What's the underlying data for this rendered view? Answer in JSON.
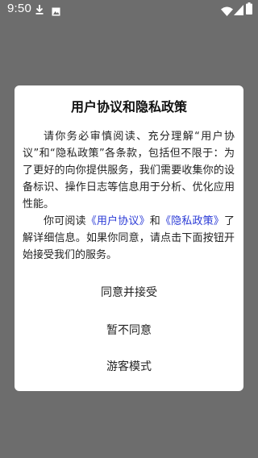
{
  "status_bar": {
    "time": "9:50",
    "icons": [
      "download-icon",
      "gallery-icon",
      "wifi-icon",
      "signal-icon",
      "battery-icon"
    ]
  },
  "dialog": {
    "title": "用户协议和隐私政策",
    "paragraph1": "请你务必审慎阅读、充分理解“用户协议”和“隐私政策”各条款，包括但不限于：为了更好的向你提供服务，我们需要收集你的设备标识、操作日志等信息用于分析、优化应用性能。",
    "paragraph2_prefix": "你可阅读",
    "link_user_agreement": "《用户协议》",
    "paragraph2_and": "和",
    "link_privacy_policy": "《隐私政策》",
    "paragraph2_suffix": "了解详细信息。如果你同意，请点击下面按钮开始接受我们的服务。",
    "agree_button": "同意并接受",
    "disagree_button": "暂不同意",
    "guest_button": "游客模式"
  },
  "colors": {
    "overlay": "#6d6d6d",
    "dialog_background": "#ffffff",
    "link": "#2b3bd6"
  }
}
